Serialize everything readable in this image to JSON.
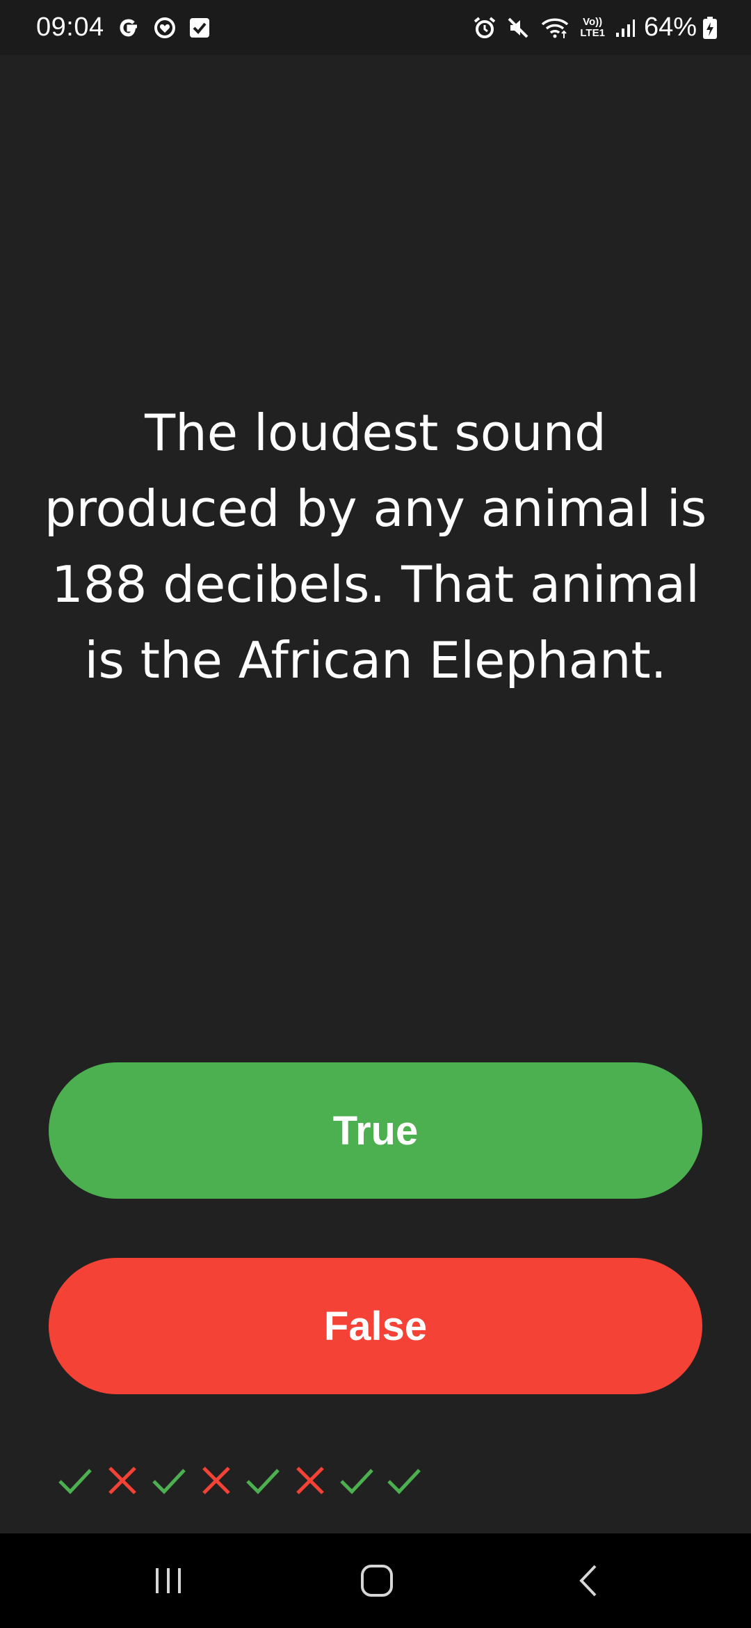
{
  "status_bar": {
    "time": "09:04",
    "left_icons": [
      "google-g-icon",
      "sync-heart-icon",
      "checkbox-icon"
    ],
    "right_icons": [
      "alarm-icon",
      "mute-icon",
      "wifi-icon",
      "volte-icon",
      "signal-icon",
      "battery-charging-icon"
    ],
    "volte_label_top": "Vo))",
    "volte_label_bottom": "LTE1",
    "battery_percent": "64%"
  },
  "question": {
    "text": "The loudest sound produced by any animal is 188 decibels. That animal is the African Elephant."
  },
  "answers": {
    "true_label": "True",
    "false_label": "False",
    "true_color": "#4caf50",
    "false_color": "#f44336"
  },
  "history": {
    "results": [
      "correct",
      "wrong",
      "correct",
      "wrong",
      "correct",
      "wrong",
      "correct",
      "correct"
    ],
    "correct_color": "#4caf50",
    "wrong_color": "#f44336"
  },
  "nav_bar": {
    "buttons": [
      "recents-icon",
      "home-icon",
      "back-icon"
    ]
  }
}
